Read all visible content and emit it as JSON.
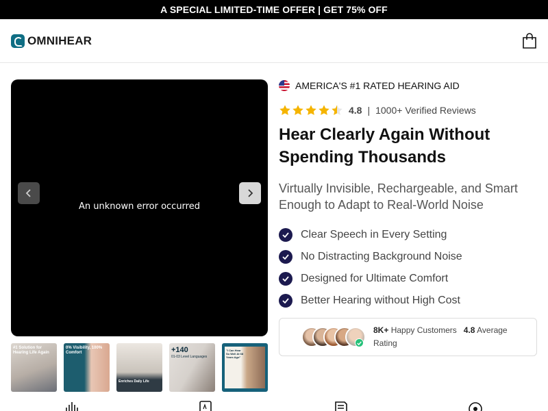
{
  "promo": {
    "text": "A SPECIAL LIMITED-TIME OFFER | GET 75% OFF"
  },
  "header": {
    "logo_text": "OMNIHEAR",
    "logo_icon": "ear-logo-icon",
    "cart_icon": "shopping-bag-icon"
  },
  "gallery": {
    "error_text": "An unknown error occurred",
    "prev_icon": "chevron-left-icon",
    "next_icon": "chevron-right-icon",
    "thumbnails": [
      {
        "caption": "#1 Solution for Hearing Life Again",
        "colors": [
          "#d9d3cc",
          "#6b6f78"
        ]
      },
      {
        "caption": "0% Visibility, 100% Comfort",
        "colors": [
          "#1d5d6e",
          "#e8c6b4"
        ]
      },
      {
        "caption": "Enriches Daily Life",
        "colors": [
          "#c9c3bb",
          "#f2efea"
        ]
      },
      {
        "caption": "+140",
        "caption_small": "01-03 Level Languages",
        "colors": [
          "#d6d1cc",
          "#8a7f77"
        ]
      },
      {
        "caption": "\"I Can Hear So Well At 68 Years Ago\"",
        "colors": [
          "#16617a",
          "#eee9e0"
        ]
      }
    ]
  },
  "product": {
    "badge_flag": "us-flag-icon",
    "badge_text": "AMERICA'S #1 RATED HEARING AID",
    "rating_value": "4.8",
    "rating_stars": 4.5,
    "reviews_text": "1000+ Verified Reviews",
    "headline": "Hear Clearly Again Without Spending Thousands",
    "subheadline": "Virtually Invisible, Rechargeable, and Smart Enough to Adapt to Real-World Noise",
    "features": [
      "Clear Speech in Every Setting",
      "No Distracting Background Noise",
      "Designed for Ultimate Comfort",
      "Better Hearing without High Cost"
    ],
    "social": {
      "customers_count": "8K+",
      "customers_label": "Happy Customers",
      "rating": "4.8",
      "rating_label": "Average Rating"
    }
  },
  "colors": {
    "promo_bg": "#000000",
    "brand_teal": "#0f6e84",
    "check_bg": "#1c1a4f",
    "star": "#f5b400",
    "verified": "#27c17a"
  }
}
